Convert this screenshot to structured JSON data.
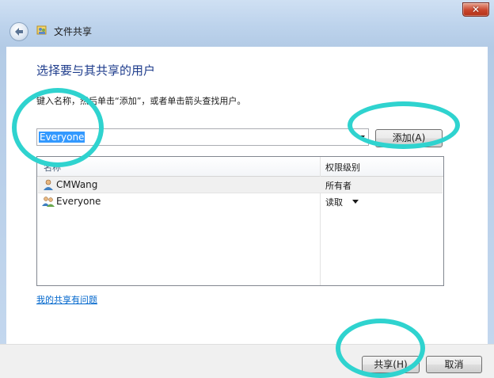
{
  "window": {
    "title": "文件共享",
    "close_glyph": "✕"
  },
  "icons": {
    "back": "back-arrow-icon",
    "app": "file-sharing-icon",
    "close": "close-icon",
    "user_single": "user-icon",
    "user_group": "user-group-icon",
    "dropdown": "chevron-down-icon"
  },
  "main": {
    "heading": "选择要与其共享的用户",
    "instruction": "键入名称，然后单击“添加”，或者单击箭头查找用户。",
    "name_input_value": "Everyone",
    "add_button": "添加(A)"
  },
  "list": {
    "columns": [
      "名称",
      "权限级别"
    ],
    "rows": [
      {
        "name": "CMWang",
        "permission": "所有者",
        "icon": "user-icon"
      },
      {
        "name": "Everyone",
        "permission": "读取",
        "icon": "user-group-icon"
      }
    ]
  },
  "help_link": "我的共享有问题",
  "footer": {
    "share_button": "共享(H)",
    "cancel_button": "取消"
  },
  "colors": {
    "heading": "#1e3c8c",
    "link": "#0066cc",
    "selection": "#3399ff",
    "annotation": "#2fd3cf",
    "chrome": "#bdd3ec",
    "close_button": "#c9452c"
  }
}
